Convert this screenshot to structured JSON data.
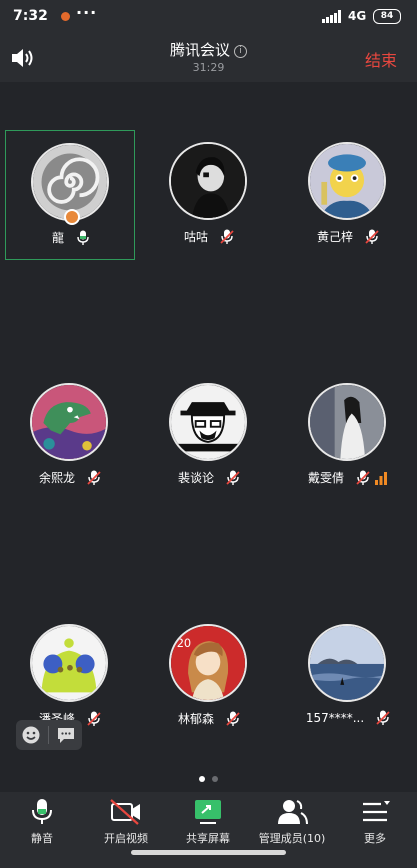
{
  "status_bar": {
    "time": "7:32",
    "dots": "···",
    "network": "4G",
    "battery": "84"
  },
  "header": {
    "title": "腾讯会议",
    "timer": "31:29",
    "end_label": "结束",
    "info_glyph": "i"
  },
  "participants": [
    {
      "name": "龍",
      "mic": "on",
      "active": true,
      "host": true,
      "avatar": "spiral"
    },
    {
      "name": "咕咕",
      "mic": "muted",
      "avatar": "dark-portrait"
    },
    {
      "name": "黄己梓",
      "mic": "muted",
      "avatar": "cartoon-yellow"
    },
    {
      "name": "余熙龙",
      "mic": "muted",
      "avatar": "dinosaur"
    },
    {
      "name": "裴谈论",
      "mic": "muted",
      "avatar": "heisenberg"
    },
    {
      "name": "戴雯倩",
      "mic": "muted",
      "avatar": "white-dress",
      "signal_bars": true
    },
    {
      "name": "潘圣峰",
      "mic": "muted",
      "avatar": "pokemon"
    },
    {
      "name": "林郁森",
      "mic": "muted",
      "avatar": "anime-girl"
    },
    {
      "name": "157****...",
      "mic": "muted",
      "avatar": "sea-view"
    }
  ],
  "pagination": {
    "pages": 2,
    "current": 1
  },
  "toolbar": {
    "mute_label": "静音",
    "video_label": "开启视频",
    "share_label": "共享屏幕",
    "members_label": "管理成员(10)",
    "more_label": "更多"
  },
  "colors": {
    "end": "#e8473f",
    "active_border": "#2f9a5a",
    "mic_on": "#3fb76a",
    "muted_slash": "#e8473f",
    "share_green": "#37c06a",
    "signal_orange": "#f08a24"
  }
}
